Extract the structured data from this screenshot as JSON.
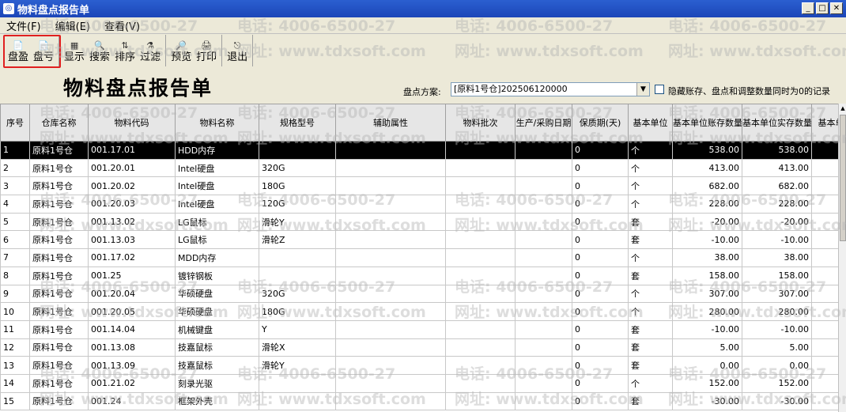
{
  "window": {
    "title": "物料盘点报告单"
  },
  "menu": [
    "文件(F)",
    "编辑(E)",
    "查看(V)"
  ],
  "toolbar": {
    "groups": [
      [
        {
          "icon": "📄",
          "label": "盘盈"
        },
        {
          "icon": "📄",
          "label": "盘亏"
        }
      ],
      [
        {
          "icon": "▦",
          "label": "显示"
        },
        {
          "icon": "🔍",
          "label": "搜索"
        },
        {
          "icon": "⇅",
          "label": "排序"
        },
        {
          "icon": "⚗",
          "label": "过滤"
        }
      ],
      [
        {
          "icon": "🔎",
          "label": "预览"
        },
        {
          "icon": "🖨",
          "label": "打印"
        }
      ],
      [
        {
          "icon": "⎋",
          "label": "退出"
        }
      ]
    ]
  },
  "report": {
    "title": "物料盘点报告单",
    "plan_label": "盘点方案:",
    "plan_value": "[原料1号仓]202506120000",
    "hide_label": "隐藏账存、盘点和调整数量同时为0的记录"
  },
  "watermarks": [
    "电话: 4006-6500-27",
    "网址: www.tdxsoft.com"
  ],
  "table": {
    "columns": [
      "序号",
      "仓库名称",
      "物料代码",
      "物料名称",
      "规格型号",
      "辅助属性",
      "物料批次",
      "生产/采购日期",
      "保质期(天)",
      "基本单位",
      "基本单位账存数量",
      "基本单位实存数量",
      "基本单"
    ],
    "rows": [
      [
        "1",
        "原料1号仓",
        "001.17.01",
        "HDD内存",
        "",
        "",
        "",
        "",
        "0",
        "个",
        "538.00",
        "538.00",
        ""
      ],
      [
        "2",
        "原料1号仓",
        "001.20.01",
        "Intel硬盘",
        "320G",
        "",
        "",
        "",
        "0",
        "个",
        "413.00",
        "413.00",
        ""
      ],
      [
        "3",
        "原料1号仓",
        "001.20.02",
        "Intel硬盘",
        "180G",
        "",
        "",
        "",
        "0",
        "个",
        "682.00",
        "682.00",
        ""
      ],
      [
        "4",
        "原料1号仓",
        "001.20.03",
        "Intel硬盘",
        "120G",
        "",
        "",
        "",
        "0",
        "个",
        "228.00",
        "228.00",
        ""
      ],
      [
        "5",
        "原料1号仓",
        "001.13.02",
        "LG鼠标",
        "滑轮Y",
        "",
        "",
        "",
        "0",
        "套",
        "-20.00",
        "-20.00",
        ""
      ],
      [
        "6",
        "原料1号仓",
        "001.13.03",
        "LG鼠标",
        "滑轮Z",
        "",
        "",
        "",
        "0",
        "套",
        "-10.00",
        "-10.00",
        ""
      ],
      [
        "7",
        "原料1号仓",
        "001.17.02",
        "MDD内存",
        "",
        "",
        "",
        "",
        "0",
        "个",
        "38.00",
        "38.00",
        ""
      ],
      [
        "8",
        "原料1号仓",
        "001.25",
        "镀锌钢板",
        "",
        "",
        "",
        "",
        "0",
        "套",
        "158.00",
        "158.00",
        ""
      ],
      [
        "9",
        "原料1号仓",
        "001.20.04",
        "华硕硬盘",
        "320G",
        "",
        "",
        "",
        "0",
        "个",
        "307.00",
        "307.00",
        ""
      ],
      [
        "10",
        "原料1号仓",
        "001.20.05",
        "华硕硬盘",
        "180G",
        "",
        "",
        "",
        "0",
        "个",
        "280.00",
        "280.00",
        ""
      ],
      [
        "11",
        "原料1号仓",
        "001.14.04",
        "机械键盘",
        "Y",
        "",
        "",
        "",
        "0",
        "套",
        "-10.00",
        "-10.00",
        ""
      ],
      [
        "12",
        "原料1号仓",
        "001.13.08",
        "技嘉鼠标",
        "滑轮X",
        "",
        "",
        "",
        "0",
        "套",
        "5.00",
        "5.00",
        ""
      ],
      [
        "13",
        "原料1号仓",
        "001.13.09",
        "技嘉鼠标",
        "滑轮Y",
        "",
        "",
        "",
        "0",
        "套",
        "0.00",
        "0.00",
        ""
      ],
      [
        "14",
        "原料1号仓",
        "001.21.02",
        "刻录光驱",
        "",
        "",
        "",
        "",
        "0",
        "个",
        "152.00",
        "152.00",
        ""
      ],
      [
        "15",
        "原料1号仓",
        "001.24",
        "框架外壳",
        "",
        "",
        "",
        "",
        "0",
        "套",
        "-30.00",
        "-30.00",
        ""
      ]
    ],
    "selected_row": 0
  }
}
